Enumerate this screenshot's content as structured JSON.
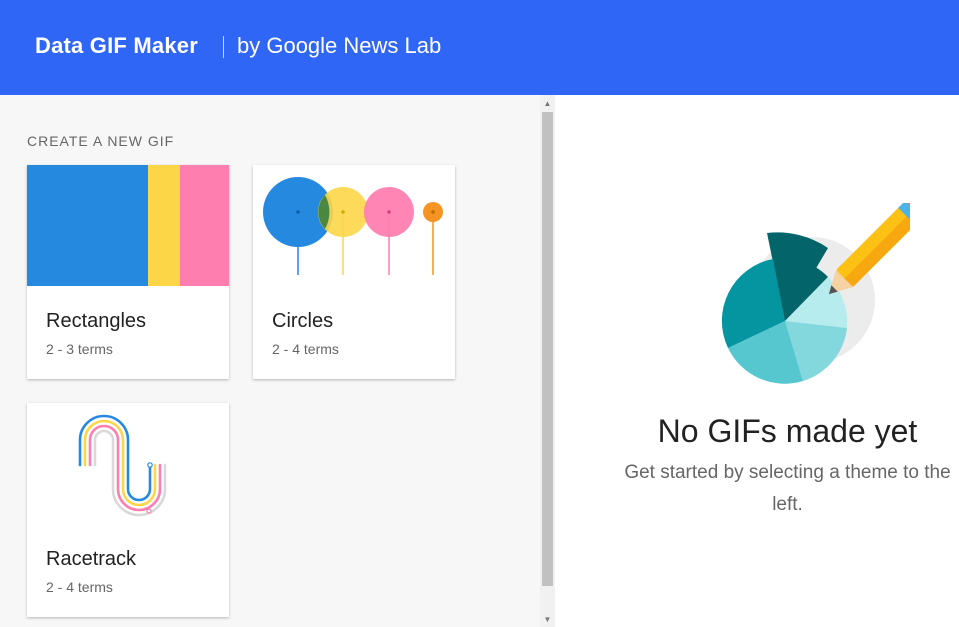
{
  "header": {
    "app_title": "Data GIF Maker",
    "byline": "by Google News Lab",
    "background_color": "#2f66f6"
  },
  "sidebar": {
    "section_title": "CREATE A NEW GIF",
    "cards": [
      {
        "title": "Rectangles",
        "subtitle": "2 - 3 terms",
        "thumbnail": "rectangles-thumbnail"
      },
      {
        "title": "Circles",
        "subtitle": "2 - 4 terms",
        "thumbnail": "circles-thumbnail"
      },
      {
        "title": "Racetrack",
        "subtitle": "2 - 4 terms",
        "thumbnail": "racetrack-thumbnail"
      }
    ]
  },
  "empty_state": {
    "title": "No GIFs made yet",
    "message": "Get started by selecting a theme to the left.",
    "illustration": "pie-chart-pencil-illustration"
  },
  "colors": {
    "blue": "#2689e0",
    "yellow": "#fdd648",
    "pink": "#ff7eb0",
    "orange": "#f59422",
    "teal_dark": "#03656a",
    "teal": "#0595a0",
    "teal_light": "#57c7cf"
  }
}
